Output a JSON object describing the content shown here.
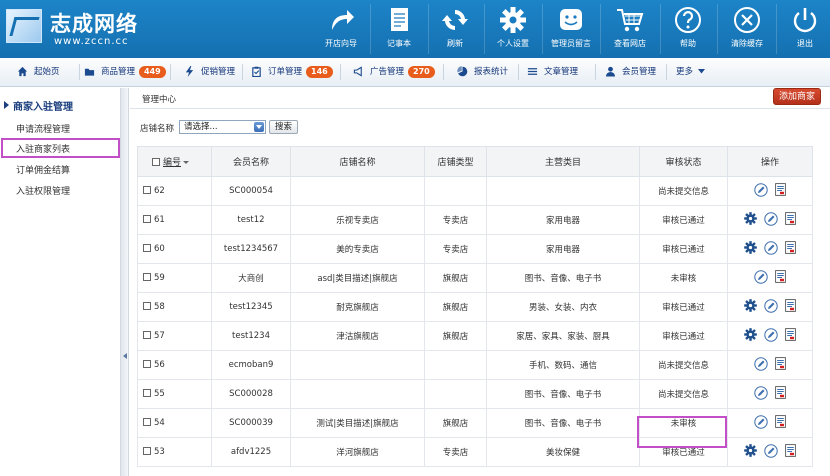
{
  "logo": {
    "title": "志成网络",
    "url": "www.zccn.cc"
  },
  "top_nav": [
    {
      "label": "开店向导",
      "icon": "share-arrow-icon"
    },
    {
      "label": "记事本",
      "icon": "notepad-icon"
    },
    {
      "label": "刷新",
      "icon": "refresh-icon"
    },
    {
      "label": "个人设置",
      "icon": "gear-icon"
    },
    {
      "label": "管理员留言",
      "icon": "smiley-message-icon"
    },
    {
      "label": "查看网店",
      "icon": "shopping-cart-icon"
    },
    {
      "label": "帮助",
      "icon": "help-icon"
    },
    {
      "label": "清除缓存",
      "icon": "clear-cache-icon"
    },
    {
      "label": "退出",
      "icon": "power-icon"
    }
  ],
  "menu": [
    {
      "label": "起始页",
      "badge": ""
    },
    {
      "label": "商品管理",
      "badge": "449"
    },
    {
      "label": "促销管理",
      "badge": ""
    },
    {
      "label": "订单管理",
      "badge": "146"
    },
    {
      "label": "广告管理",
      "badge": "270"
    },
    {
      "label": "报表统计",
      "badge": ""
    },
    {
      "label": "文章管理",
      "badge": ""
    },
    {
      "label": "会员管理",
      "badge": ""
    },
    {
      "label": "更多",
      "badge": ""
    }
  ],
  "sidebar": {
    "title": "商家入驻管理",
    "items": [
      {
        "label": "申请流程管理"
      },
      {
        "label": "入驻商家列表"
      },
      {
        "label": "订单佣金结算"
      },
      {
        "label": "入驻权限管理"
      }
    ]
  },
  "main": {
    "breadcrumb": "管理中心",
    "add_button": "添加商家",
    "search": {
      "label": "店铺名称",
      "select_value": "请选择...",
      "button": "搜索"
    },
    "columns": {
      "id": "编号",
      "member": "会员名称",
      "shop": "店铺名称",
      "type": "店铺类型",
      "category": "主营类目",
      "status": "审核状态",
      "ops": "操作"
    },
    "rows": [
      {
        "id": "62",
        "member": "SC000054",
        "shop": "",
        "type": "",
        "category": "",
        "status": "尚未提交信息",
        "status_kind": "none",
        "gear": false
      },
      {
        "id": "61",
        "member": "test12",
        "shop": "乐视专卖店",
        "type": "专卖店",
        "category": "家用电器",
        "status": "审核已通过",
        "status_kind": "ok",
        "gear": true
      },
      {
        "id": "60",
        "member": "test1234567",
        "shop": "美的专卖店",
        "type": "专卖店",
        "category": "家用电器",
        "status": "审核已通过",
        "status_kind": "ok",
        "gear": true
      },
      {
        "id": "59",
        "member": "大商创",
        "shop": "asd|类目描述|旗舰店",
        "type": "旗舰店",
        "category": "图书、音像、电子书",
        "status": "未审核",
        "status_kind": "pending",
        "gear": false
      },
      {
        "id": "58",
        "member": "test12345",
        "shop": "耐克旗舰店",
        "type": "旗舰店",
        "category": "男装、女装、内衣",
        "status": "审核已通过",
        "status_kind": "ok",
        "gear": true
      },
      {
        "id": "57",
        "member": "test1234",
        "shop": "津沽旗舰店",
        "type": "旗舰店",
        "category": "家居、家具、家装、厨具",
        "status": "审核已通过",
        "status_kind": "ok",
        "gear": true
      },
      {
        "id": "56",
        "member": "ecmoban9",
        "shop": "",
        "type": "",
        "category": "手机、数码、通信",
        "status": "尚未提交信息",
        "status_kind": "none",
        "gear": false
      },
      {
        "id": "55",
        "member": "SC000028",
        "shop": "",
        "type": "",
        "category": "图书、音像、电子书",
        "status": "尚未提交信息",
        "status_kind": "none",
        "gear": false
      },
      {
        "id": "54",
        "member": "SC000039",
        "shop": "测试|类目描述|旗舰店",
        "type": "旗舰店",
        "category": "图书、音像、电子书",
        "status": "未审核",
        "status_kind": "pending",
        "gear": false
      },
      {
        "id": "53",
        "member": "afdv1225",
        "shop": "洋河旗舰店",
        "type": "专卖店",
        "category": "美妆保健",
        "status": "审核已通过",
        "status_kind": "ok",
        "gear": true
      }
    ]
  },
  "colors": {
    "header_blue": "#1470b0",
    "badge_orange": "#e85d1b",
    "shop_red": "#d52020",
    "highlight_purple": "#c34fc8",
    "status_orange": "#e7961d",
    "status_blue": "#1f4fa8"
  }
}
